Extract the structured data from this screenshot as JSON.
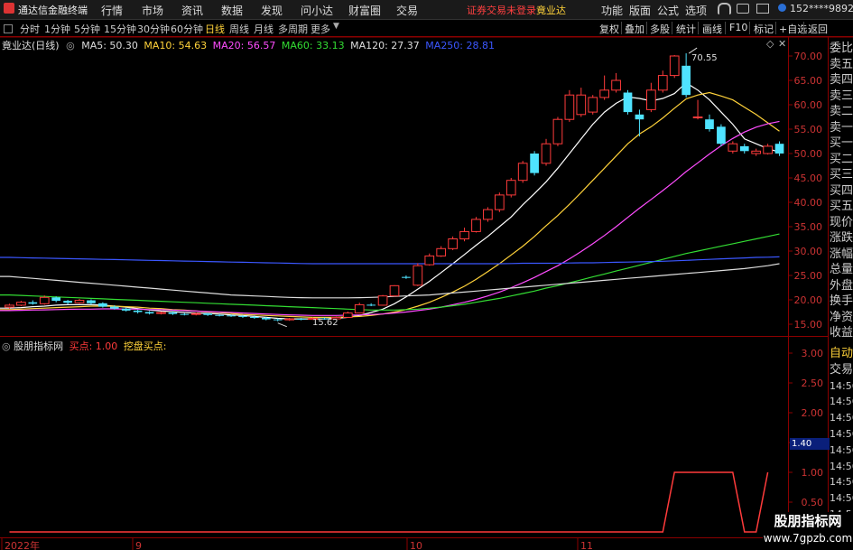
{
  "app": {
    "title": "通达信金融终端"
  },
  "menu": [
    "行情",
    "市场",
    "资讯",
    "数据",
    "发现",
    "问小达",
    "财富圈",
    "交易"
  ],
  "login_status": "证券交易未登录",
  "login_stock": "竟业达",
  "right_menu": [
    "功能",
    "版面",
    "公式",
    "选项"
  ],
  "user": "152****9892",
  "window_controls": {
    "min": "—",
    "restore": "▭",
    "close": "✕"
  },
  "periods": [
    "分时",
    "1分钟",
    "5分钟",
    "15分钟",
    "30分钟",
    "60分钟",
    "日线",
    "周线",
    "月线",
    "多周期",
    "更多"
  ],
  "active_period": "日线",
  "toolbar_right": [
    "复权",
    "叠加",
    "多股",
    "统计",
    "画线",
    "F10",
    "标记",
    "+自选",
    "返回"
  ],
  "stock": {
    "name": "竟业达(日线)"
  },
  "ma": [
    {
      "label": "MA5: 50.30",
      "color": "#ffffff"
    },
    {
      "label": "MA10: 54.63",
      "color": "#ffd23a"
    },
    {
      "label": "MA20: 56.57",
      "color": "#ff4dff"
    },
    {
      "label": "MA60: 33.13",
      "color": "#33dd33"
    },
    {
      "label": "MA120: 27.37",
      "color": "#dddddd"
    },
    {
      "label": "MA250: 28.81",
      "color": "#3b57ff"
    }
  ],
  "price_axis": [
    "70.00",
    "65.00",
    "60.00",
    "55.00",
    "50.00",
    "45.00",
    "40.00",
    "35.00",
    "30.00",
    "25.00",
    "20.00",
    "15.00"
  ],
  "annotations": {
    "high": "70.55",
    "low": "15.62"
  },
  "indicator": {
    "name": "股朋指标网",
    "buy_label": "买点: 1.00",
    "dig_label": "挖盘买点:"
  },
  "indicator_axis": [
    "3.00",
    "2.50",
    "2.00",
    "1.50",
    "1.00",
    "0.50"
  ],
  "indicator_marker": "1.40",
  "date_axis": [
    "2022年",
    "9",
    "10",
    "11"
  ],
  "side_panel": [
    "委比",
    "卖五",
    "卖四",
    "卖三",
    "卖二",
    "卖一",
    "买一",
    "买二",
    "买三",
    "买四",
    "买五",
    "现价",
    "涨跌",
    "涨幅",
    "总量",
    "外盘",
    "换手",
    "净资",
    "收益"
  ],
  "side_panel_lower": [
    "自动",
    "交易",
    "14:56",
    "14:56",
    "14:56",
    "14:56",
    "14:56",
    "14:56",
    "14:56",
    "14:56",
    "14:56",
    "14:56"
  ],
  "watermark": {
    "line1": "股朋指标网",
    "line2": "www.7gpzb.com"
  },
  "chart_data": {
    "type": "candlestick",
    "ylim": [
      13,
      73
    ],
    "candles": [
      {
        "o": 18.5,
        "c": 18.9,
        "h": 19.2,
        "l": 18.2
      },
      {
        "o": 18.9,
        "c": 19.5,
        "h": 19.8,
        "l": 18.7
      },
      {
        "o": 19.5,
        "c": 19.2,
        "h": 19.9,
        "l": 19.0
      },
      {
        "o": 19.2,
        "c": 20.5,
        "h": 20.9,
        "l": 19.0
      },
      {
        "o": 20.5,
        "c": 19.8,
        "h": 20.7,
        "l": 19.5
      },
      {
        "o": 19.8,
        "c": 19.4,
        "h": 20.0,
        "l": 19.1
      },
      {
        "o": 19.4,
        "c": 19.9,
        "h": 20.2,
        "l": 19.2
      },
      {
        "o": 19.9,
        "c": 19.3,
        "h": 20.1,
        "l": 19.0
      },
      {
        "o": 19.3,
        "c": 18.6,
        "h": 19.5,
        "l": 18.4
      },
      {
        "o": 18.6,
        "c": 18.2,
        "h": 18.9,
        "l": 18.0
      },
      {
        "o": 18.2,
        "c": 17.8,
        "h": 18.4,
        "l": 17.6
      },
      {
        "o": 17.8,
        "c": 17.5,
        "h": 18.0,
        "l": 17.2
      },
      {
        "o": 17.5,
        "c": 17.2,
        "h": 17.7,
        "l": 17.0
      },
      {
        "o": 17.2,
        "c": 17.4,
        "h": 17.6,
        "l": 17.0
      },
      {
        "o": 17.4,
        "c": 17.1,
        "h": 17.6,
        "l": 16.9
      },
      {
        "o": 17.1,
        "c": 17.0,
        "h": 17.3,
        "l": 16.8
      },
      {
        "o": 17.0,
        "c": 17.2,
        "h": 17.4,
        "l": 16.8
      },
      {
        "o": 17.2,
        "c": 16.9,
        "h": 17.3,
        "l": 16.7
      },
      {
        "o": 16.9,
        "c": 16.8,
        "h": 17.1,
        "l": 16.6
      },
      {
        "o": 16.8,
        "c": 16.7,
        "h": 17.0,
        "l": 16.5
      },
      {
        "o": 16.7,
        "c": 16.5,
        "h": 16.9,
        "l": 16.3
      },
      {
        "o": 16.5,
        "c": 16.3,
        "h": 16.8,
        "l": 16.1
      },
      {
        "o": 16.3,
        "c": 16.0,
        "h": 16.5,
        "l": 15.8
      },
      {
        "o": 16.0,
        "c": 15.9,
        "h": 16.2,
        "l": 15.6
      },
      {
        "o": 15.9,
        "c": 16.1,
        "h": 16.3,
        "l": 15.7
      },
      {
        "o": 16.1,
        "c": 16.0,
        "h": 16.3,
        "l": 15.8
      },
      {
        "o": 16.0,
        "c": 16.2,
        "h": 16.4,
        "l": 15.9
      },
      {
        "o": 16.2,
        "c": 16.1,
        "h": 16.4,
        "l": 15.9
      },
      {
        "o": 16.1,
        "c": 16.4,
        "h": 16.6,
        "l": 16.0
      },
      {
        "o": 16.4,
        "c": 17.3,
        "h": 17.6,
        "l": 16.3
      },
      {
        "o": 17.3,
        "c": 19.0,
        "h": 19.4,
        "l": 17.2
      },
      {
        "o": 19.0,
        "c": 18.9,
        "h": 19.3,
        "l": 18.7
      },
      {
        "o": 18.9,
        "c": 20.8,
        "h": 21.0,
        "l": 18.8
      },
      {
        "o": 20.8,
        "c": 22.9,
        "h": 23.0,
        "l": 20.7
      },
      {
        "o": 24.7,
        "c": 24.5,
        "h": 25.0,
        "l": 24.3
      },
      {
        "o": 23.0,
        "c": 27.0,
        "h": 27.5,
        "l": 22.8
      },
      {
        "o": 27.2,
        "c": 29.0,
        "h": 29.5,
        "l": 27.0
      },
      {
        "o": 29.0,
        "c": 30.5,
        "h": 31.0,
        "l": 28.8
      },
      {
        "o": 30.5,
        "c": 32.5,
        "h": 33.0,
        "l": 30.2
      },
      {
        "o": 32.5,
        "c": 34.0,
        "h": 34.8,
        "l": 32.0
      },
      {
        "o": 34.0,
        "c": 36.5,
        "h": 37.0,
        "l": 33.8
      },
      {
        "o": 36.5,
        "c": 38.5,
        "h": 39.0,
        "l": 36.0
      },
      {
        "o": 38.5,
        "c": 41.5,
        "h": 42.0,
        "l": 38.0
      },
      {
        "o": 41.5,
        "c": 44.5,
        "h": 45.0,
        "l": 41.0
      },
      {
        "o": 44.5,
        "c": 48.0,
        "h": 48.5,
        "l": 44.0
      },
      {
        "o": 50.0,
        "c": 46.0,
        "h": 50.5,
        "l": 45.5
      },
      {
        "o": 48.0,
        "c": 52.0,
        "h": 53.0,
        "l": 47.5
      },
      {
        "o": 52.0,
        "c": 57.0,
        "h": 57.5,
        "l": 51.5
      },
      {
        "o": 57.0,
        "c": 62.0,
        "h": 63.0,
        "l": 56.5
      },
      {
        "o": 58.0,
        "c": 62.0,
        "h": 63.5,
        "l": 57.5
      },
      {
        "o": 58.5,
        "c": 61.5,
        "h": 62.0,
        "l": 58.0
      },
      {
        "o": 61.5,
        "c": 63.0,
        "h": 66.0,
        "l": 61.0
      },
      {
        "o": 63.0,
        "c": 65.0,
        "h": 66.5,
        "l": 62.5
      },
      {
        "o": 62.5,
        "c": 58.5,
        "h": 63.0,
        "l": 58.0
      },
      {
        "o": 58.0,
        "c": 57.0,
        "h": 59.0,
        "l": 53.5
      },
      {
        "o": 59.0,
        "c": 63.0,
        "h": 64.5,
        "l": 58.5
      },
      {
        "o": 63.0,
        "c": 66.0,
        "h": 67.0,
        "l": 62.5
      },
      {
        "o": 66.0,
        "c": 70.0,
        "h": 70.2,
        "l": 65.5
      },
      {
        "o": 68.0,
        "c": 62.0,
        "h": 70.55,
        "l": 61.5
      },
      {
        "o": 57.5,
        "c": 57.5,
        "h": 61.0,
        "l": 57.0
      },
      {
        "o": 57.0,
        "c": 55.0,
        "h": 58.0,
        "l": 54.5
      },
      {
        "o": 55.5,
        "c": 52.0,
        "h": 56.0,
        "l": 51.5
      },
      {
        "o": 50.5,
        "c": 52.0,
        "h": 52.5,
        "l": 50.0
      },
      {
        "o": 51.5,
        "c": 50.5,
        "h": 52.0,
        "l": 50.0
      },
      {
        "o": 50.0,
        "c": 50.5,
        "h": 51.0,
        "l": 49.5
      },
      {
        "o": 50.0,
        "c": 51.5,
        "h": 52.0,
        "l": 49.8
      },
      {
        "o": 52.0,
        "c": 50.0,
        "h": 52.5,
        "l": 49.5
      }
    ],
    "ma_lines": {
      "MA5": [
        18.3,
        18.4,
        18.6,
        18.7,
        18.9,
        19.0,
        19.0,
        19.0,
        18.9,
        18.7,
        18.5,
        18.2,
        17.9,
        17.7,
        17.6,
        17.4,
        17.3,
        17.2,
        17.1,
        16.9,
        16.8,
        16.6,
        16.4,
        16.2,
        16.1,
        16.1,
        16.1,
        16.1,
        16.2,
        16.4,
        16.8,
        17.4,
        18.1,
        19.2,
        20.6,
        22.2,
        23.8,
        25.6,
        27.4,
        29.3,
        31.2,
        33.0,
        35.0,
        37.0,
        39.5,
        41.8,
        44.2,
        47.0,
        50.0,
        53.0,
        56.0,
        58.5,
        60.3,
        61.6,
        61.3,
        60.8,
        61.3,
        62.3,
        64.5,
        63.0,
        61.0,
        58.5,
        56.0,
        53.0,
        52.0,
        51.0,
        50.3
      ],
      "MA10": [
        18.0,
        18.1,
        18.2,
        18.3,
        18.4,
        18.5,
        18.6,
        18.7,
        18.7,
        18.7,
        18.6,
        18.5,
        18.3,
        18.2,
        18.0,
        17.9,
        17.7,
        17.5,
        17.4,
        17.2,
        17.0,
        16.9,
        16.8,
        16.7,
        16.6,
        16.5,
        16.4,
        16.4,
        16.4,
        16.5,
        16.6,
        16.8,
        17.1,
        17.5,
        18.0,
        18.7,
        19.5,
        20.5,
        21.6,
        22.8,
        24.2,
        25.8,
        27.4,
        29.2,
        31.0,
        33.0,
        35.2,
        37.3,
        39.6,
        42.0,
        44.5,
        47.0,
        49.5,
        52.0,
        54.0,
        55.5,
        57.3,
        59.3,
        61.2,
        62.0,
        62.5,
        61.8,
        61.0,
        59.5,
        58.0,
        56.3,
        54.6
      ],
      "MA20": [
        17.8,
        17.85,
        17.9,
        17.95,
        18.0,
        18.05,
        18.1,
        18.1,
        18.15,
        18.15,
        18.1,
        18.1,
        18.0,
        18.0,
        17.9,
        17.8,
        17.7,
        17.6,
        17.5,
        17.4,
        17.3,
        17.2,
        17.1,
        17.0,
        16.9,
        16.85,
        16.8,
        16.8,
        16.8,
        16.85,
        16.9,
        17.0,
        17.1,
        17.3,
        17.5,
        17.8,
        18.1,
        18.5,
        19.0,
        19.5,
        20.1,
        20.8,
        21.6,
        22.5,
        23.5,
        24.6,
        25.8,
        27.0,
        28.4,
        29.9,
        31.5,
        33.2,
        35.0,
        36.9,
        38.8,
        40.6,
        42.4,
        44.3,
        46.3,
        48.1,
        49.9,
        51.6,
        53.1,
        54.4,
        55.4,
        56.1,
        56.6
      ],
      "MA60": [
        21.0,
        20.9,
        20.8,
        20.7,
        20.6,
        20.5,
        20.4,
        20.3,
        20.2,
        20.1,
        20.0,
        19.9,
        19.8,
        19.7,
        19.6,
        19.5,
        19.4,
        19.3,
        19.2,
        19.1,
        19.0,
        18.9,
        18.8,
        18.7,
        18.6,
        18.5,
        18.4,
        18.3,
        18.2,
        18.1,
        18.0,
        17.9,
        17.9,
        17.9,
        18.0,
        18.1,
        18.3,
        18.5,
        18.8,
        19.1,
        19.5,
        19.9,
        20.3,
        20.8,
        21.3,
        21.8,
        22.4,
        22.9,
        23.5,
        24.1,
        24.7,
        25.3,
        25.9,
        26.5,
        27.1,
        27.7,
        28.3,
        28.9,
        29.5,
        30.0,
        30.5,
        31.0,
        31.5,
        32.0,
        32.5,
        33.0,
        33.5
      ],
      "MA120": [
        24.8,
        24.6,
        24.4,
        24.2,
        24.0,
        23.8,
        23.6,
        23.4,
        23.2,
        23.0,
        22.8,
        22.6,
        22.4,
        22.2,
        22.0,
        21.8,
        21.6,
        21.4,
        21.2,
        21.0,
        20.9,
        20.8,
        20.7,
        20.6,
        20.5,
        20.45,
        20.4,
        20.4,
        20.4,
        20.4,
        20.45,
        20.5,
        20.6,
        20.7,
        20.8,
        20.9,
        21.0,
        21.2,
        21.4,
        21.6,
        21.8,
        22.0,
        22.2,
        22.4,
        22.6,
        22.8,
        23.0,
        23.2,
        23.4,
        23.6,
        23.8,
        24.0,
        24.2,
        24.4,
        24.6,
        24.8,
        25.0,
        25.2,
        25.4,
        25.6,
        25.8,
        26.0,
        26.2,
        26.4,
        26.7,
        27.0,
        27.4
      ],
      "MA250": [
        28.7,
        28.65,
        28.6,
        28.55,
        28.5,
        28.45,
        28.4,
        28.35,
        28.3,
        28.25,
        28.2,
        28.15,
        28.1,
        28.05,
        28.0,
        27.95,
        27.9,
        27.85,
        27.8,
        27.75,
        27.7,
        27.65,
        27.6,
        27.55,
        27.5,
        27.45,
        27.4,
        27.4,
        27.4,
        27.4,
        27.4,
        27.4,
        27.4,
        27.4,
        27.4,
        27.4,
        27.4,
        27.4,
        27.4,
        27.4,
        27.4,
        27.4,
        27.4,
        27.45,
        27.5,
        27.5,
        27.5,
        27.5,
        27.55,
        27.6,
        27.6,
        27.65,
        27.7,
        27.75,
        27.8,
        27.85,
        27.9,
        28.0,
        28.1,
        28.2,
        28.3,
        28.4,
        28.5,
        28.6,
        28.7,
        28.75,
        28.81
      ]
    },
    "indicator_series": [
      0,
      0,
      0,
      0,
      0,
      0,
      0,
      0,
      0,
      0,
      0,
      0,
      0,
      0,
      0,
      0,
      0,
      0,
      0,
      0,
      0,
      0,
      0,
      0,
      0,
      0,
      0,
      0,
      0,
      0,
      0,
      0,
      0,
      0,
      0,
      0,
      0,
      0,
      0,
      0,
      0,
      0,
      0,
      0,
      0,
      0,
      0,
      0,
      0,
      0,
      0,
      0,
      0,
      0,
      0,
      0,
      0,
      1,
      1,
      1,
      1,
      1,
      1,
      0,
      0,
      1
    ],
    "indicator_ylim": [
      0,
      3.3
    ]
  }
}
